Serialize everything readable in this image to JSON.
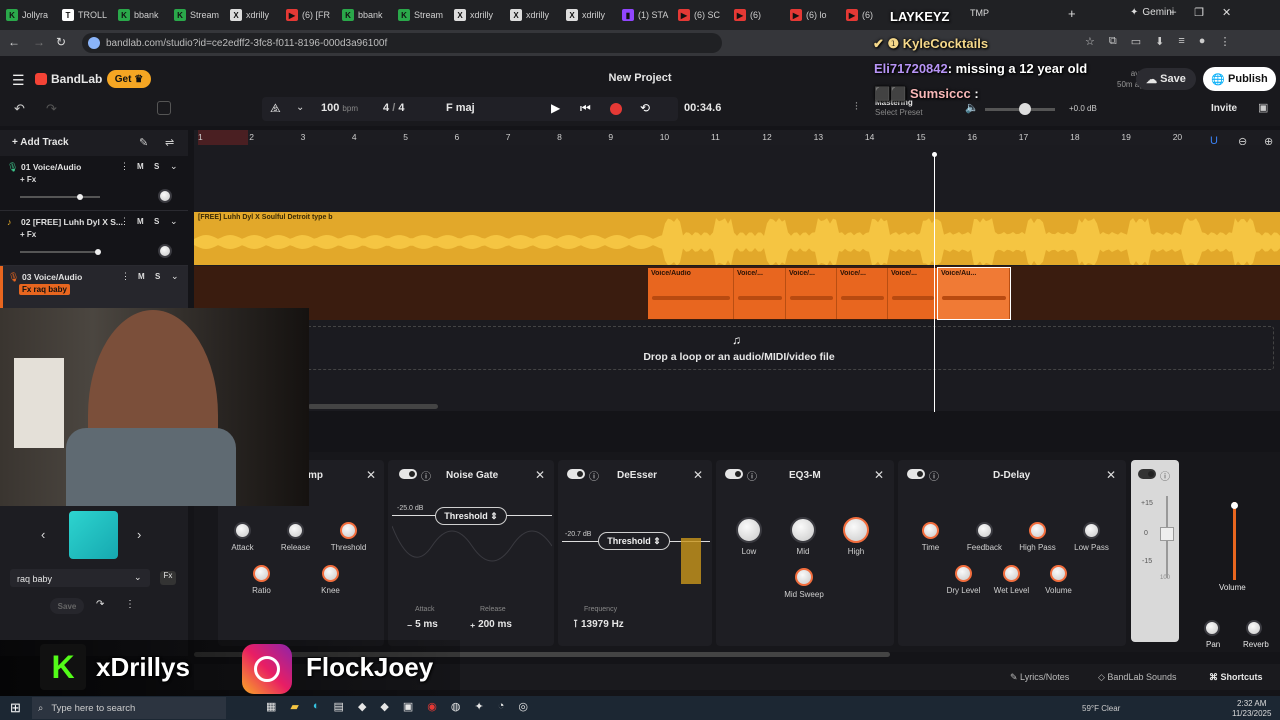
{
  "browser": {
    "tabs": [
      {
        "label": "Jollyra",
        "color": "#2aa84a",
        "glyph": "K"
      },
      {
        "label": "TROLL",
        "color": "#ffffff",
        "glyph": "T"
      },
      {
        "label": "bbank",
        "color": "#2aa84a",
        "glyph": "K"
      },
      {
        "label": "Stream",
        "color": "#2aa84a",
        "glyph": "K"
      },
      {
        "label": "xdrilly",
        "color": "#dddddd",
        "glyph": "X"
      },
      {
        "label": "(6) [FR",
        "color": "#e53935",
        "glyph": "▶"
      },
      {
        "label": "bbank",
        "color": "#2aa84a",
        "glyph": "K"
      },
      {
        "label": "Stream",
        "color": "#2aa84a",
        "glyph": "K"
      },
      {
        "label": "xdrilly",
        "color": "#dddddd",
        "glyph": "X"
      },
      {
        "label": "xdrilly",
        "color": "#dddddd",
        "glyph": "X"
      },
      {
        "label": "xdrilly",
        "color": "#dddddd",
        "glyph": "X"
      },
      {
        "label": "(1) STA",
        "color": "#9146ff",
        "glyph": "▮"
      },
      {
        "label": "(6) SC",
        "color": "#e53935",
        "glyph": "▶"
      },
      {
        "label": "(6)",
        "color": "#e53935",
        "glyph": "▶"
      },
      {
        "label": "(6) lo",
        "color": "#e53935",
        "glyph": "▶"
      },
      {
        "label": "(6)",
        "color": "#e53935",
        "glyph": "▶"
      }
    ],
    "right_tab": "Gemini",
    "tmp_tab": "TMP",
    "url": "bandlab.com/studio?id=ce2edff2-3fc8-f011-8196-000d3a96100f"
  },
  "app": {
    "logo": "BandLab",
    "get_button": "Get",
    "project_title": "New Project",
    "save_button": "Save",
    "publish_button": "Publish",
    "invite_button": "Invite",
    "saved_label": "aved",
    "saved_time": "50m ago",
    "bpm_value": "100",
    "bpm_unit": "bpm",
    "time_sig_num": "4",
    "time_sig_sep": "/",
    "time_sig_den": "4",
    "key": "F maj",
    "time_display": "00:34.6",
    "mastering_label": "Mastering",
    "mastering_preset": "Select Preset",
    "volume_db": "+0.0 dB"
  },
  "chat": [
    {
      "user": "LAYKEYZ",
      "message": ""
    },
    {
      "user": "KyleCocktails",
      "message": ""
    },
    {
      "user": "Eli71720842",
      "message": ": missing a 12 year old"
    },
    {
      "user": "Sumsiccc",
      "message": ":"
    }
  ],
  "tracks": [
    {
      "name": "01  Voice/Audio",
      "fx": "+ Fx",
      "m": "M",
      "s": "S"
    },
    {
      "name": "02  [FREE] Luhh Dyl X S...",
      "fx": "+ Fx",
      "m": "M",
      "s": "S"
    },
    {
      "name": "03  Voice/Audio",
      "fx": "Fx raq baby",
      "m": "M",
      "s": "S"
    }
  ],
  "add_track": "Add Track",
  "ruler": [
    "1",
    "2",
    "3",
    "4",
    "5",
    "6",
    "7",
    "8",
    "9",
    "10",
    "11",
    "12",
    "13",
    "14",
    "15",
    "16",
    "17",
    "18",
    "19",
    "20"
  ],
  "clip_title": "[FREE] Luhh Dyl X Soulful Detroit type b",
  "voice_clips": [
    "Voice/Audio",
    "Voice/...",
    "Voice/...",
    "Voice/...",
    "Voice/...",
    "Voice/Au..."
  ],
  "drop_hint": "Drop a loop or an audio/MIDI/video file",
  "effects": {
    "comp_title": "mp",
    "comp_knobs": [
      "Attack",
      "Release",
      "Threshold",
      "Ratio",
      "Knee"
    ],
    "noise_gate": {
      "title": "Noise Gate",
      "db": "-25.0 dB",
      "pill": "Threshold",
      "attack_label": "Attack",
      "attack_value": "5 ms",
      "release_label": "Release",
      "release_value": "200 ms"
    },
    "deesser": {
      "title": "DeEsser",
      "db": "-20.7 dB",
      "pill": "Threshold",
      "freq_label": "Frequency",
      "freq_value": "13979 Hz"
    },
    "eq": {
      "title": "EQ3-M",
      "knobs": [
        "Low",
        "Mid",
        "High",
        "Mid Sweep"
      ]
    },
    "delay": {
      "title": "D-Delay",
      "knobs": [
        "Time",
        "Feedback",
        "High Pass",
        "Low Pass",
        "Dry Level",
        "Wet Level",
        "Volume"
      ]
    },
    "meter_labels": [
      "+15",
      "0",
      "-15",
      "100"
    ],
    "master": {
      "volume": "Volume",
      "pan": "Pan",
      "reverb": "Reverb"
    }
  },
  "preset_panel": {
    "name": "raq baby",
    "save": "Save"
  },
  "bottom": {
    "lyrics": "Lyrics/Notes",
    "sounds": "BandLab Sounds",
    "shortcuts": "Shortcuts"
  },
  "overlay": {
    "kick_name": "xDrillys",
    "insta_name": "FlockJoey"
  },
  "taskbar": {
    "search": "Type here to search",
    "weather": "59°F  Clear",
    "time": "2:32 AM",
    "date": "11/23/2025"
  },
  "colors": {
    "accent": "#f26d3d",
    "track2": "#f0b429",
    "track3": "#e8661f",
    "brand": "#f44336"
  }
}
